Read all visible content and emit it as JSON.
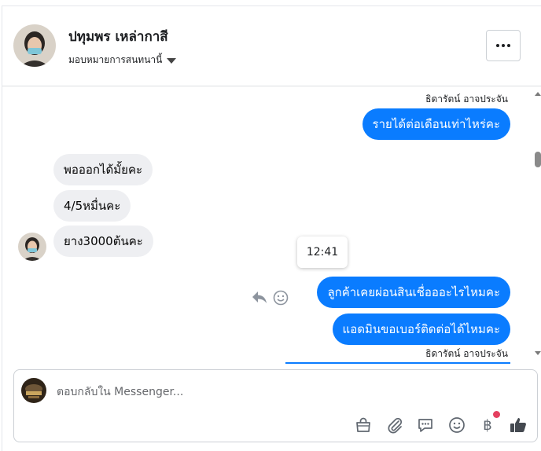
{
  "header": {
    "contact_name": "ปทุมพร เหล่ากาสี",
    "assign_label": "มอบหมายการสนทนานี้",
    "more_label": "More options"
  },
  "thread": {
    "sender_top": "ธิดารัตน์ อาจประจัน",
    "messages": [
      {
        "text": "รายได้ต่อเดือนเท่าไหร่คะ"
      },
      {
        "text": "พอออกได้มั้ยคะ"
      },
      {
        "text": "4/5หมื่นคะ"
      },
      {
        "text": "ยาง3000ต้นคะ"
      },
      {
        "text": "ลูกค้าเคยผ่อนสินเชื่อออะไรไหมคะ"
      },
      {
        "text": "แอดมินขอเบอร์ติดต่อได้ไหมคะ"
      }
    ],
    "tooltip_time": "12:41",
    "sender_bottom": "ธิดารัตน์ อาจประจัน"
  },
  "composer": {
    "placeholder": "ตอบกลับใน Messenger..."
  },
  "icons": {
    "accent": "#0a7cff",
    "incoming_bg": "#eeeff2",
    "notification_dot": "#e4405f"
  }
}
